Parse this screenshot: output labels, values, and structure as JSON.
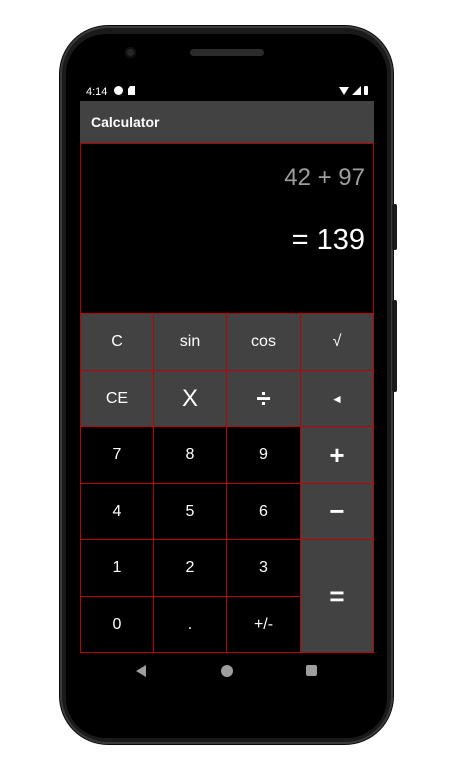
{
  "status_bar": {
    "time": "4:14"
  },
  "app_bar": {
    "title": "Calculator"
  },
  "display": {
    "expression": "42 + 97",
    "result": "= 139"
  },
  "keys": {
    "row1": [
      "C",
      "sin",
      "cos",
      "√"
    ],
    "row2": [
      "CE",
      "X",
      "÷",
      "◄"
    ],
    "row3": [
      "7",
      "8",
      "9",
      "+"
    ],
    "row4": [
      "4",
      "5",
      "6",
      "−"
    ],
    "row5": [
      "1",
      "2",
      "3"
    ],
    "row6": [
      "0",
      ".",
      "+/-"
    ],
    "equals": "="
  },
  "colors": {
    "key_gray": "#424242",
    "key_black": "#000000",
    "key_border": "#c00000",
    "app_bar": "#424242",
    "expression_text": "#9e9e9e"
  },
  "icons": {
    "status_left": [
      "nav-app-icon",
      "sd-card-icon"
    ],
    "status_right": [
      "wifi-icon",
      "signal-icon",
      "battery-icon"
    ],
    "nav": [
      "back-icon",
      "home-icon",
      "recents-icon"
    ]
  }
}
